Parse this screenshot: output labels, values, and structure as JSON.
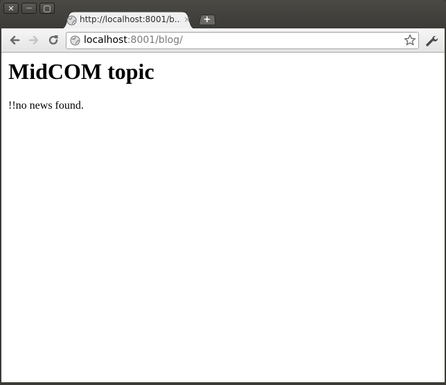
{
  "window": {
    "controls": {
      "close_symbol": "✕",
      "minimize_symbol": "—",
      "maximize_symbol": "▢"
    }
  },
  "tab": {
    "title": "http://localhost:8001/b...",
    "close_symbol": "×",
    "favicon": "globe-icon"
  },
  "new_tab": {
    "symbol": "+"
  },
  "toolbar": {
    "back_icon": "arrow-left-icon",
    "forward_icon": "arrow-right-icon",
    "reload_icon": "reload-icon",
    "menu_icon": "wrench-icon"
  },
  "omnibox": {
    "host": "localhost",
    "rest": ":8001/blog/",
    "bookmark_icon": "star-icon"
  },
  "page": {
    "title": "MidCOM topic",
    "message": "!!no news found."
  },
  "colors": {
    "window_frame": "#3c3b37",
    "toolbar": "#ececec",
    "url_host": "#000000",
    "url_path": "#7a7a7a",
    "page_bg": "#ffffff"
  }
}
